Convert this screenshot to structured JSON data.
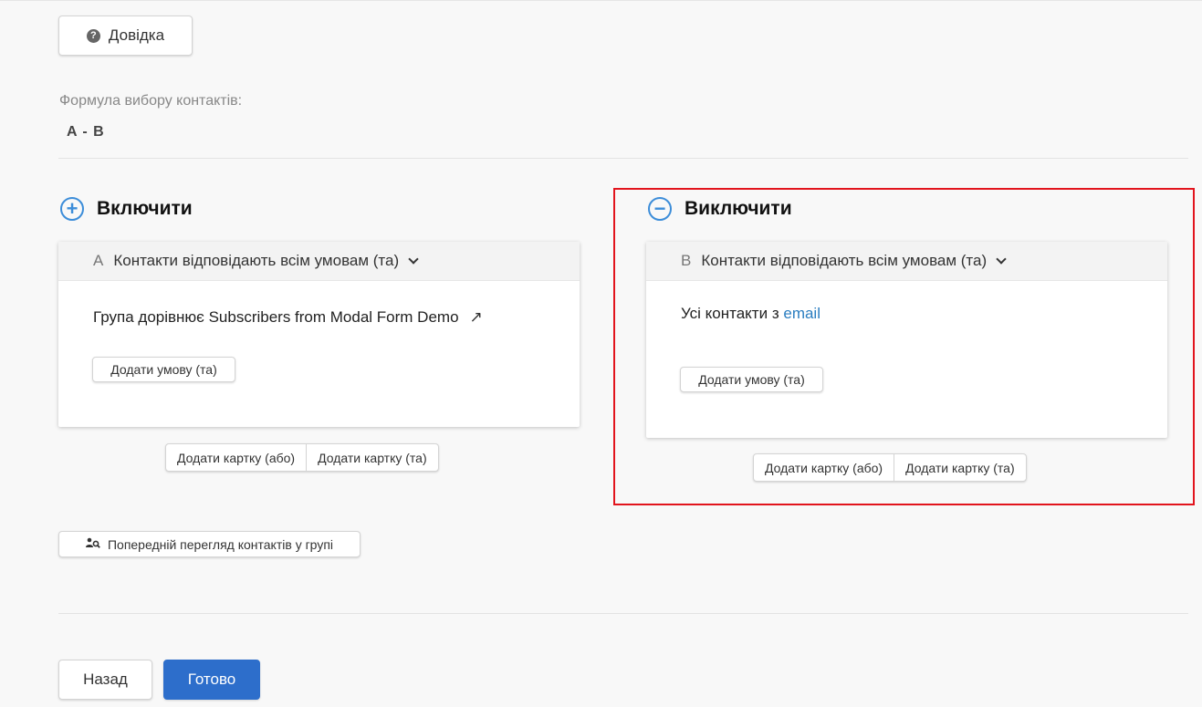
{
  "help": {
    "label": "Довідка"
  },
  "formula": {
    "label": "Формула вибору контактів:",
    "value": "A - B"
  },
  "include": {
    "title": "Включити",
    "card": {
      "letter": "A",
      "match": "Контакти відповідають всім умовам (та)",
      "condition": "Група дорівнює Subscribers from Modal Form Demo",
      "add_condition": "Додати умову (та)"
    },
    "add_card_or": "Додати картку (або)",
    "add_card_and": "Додати картку (та)"
  },
  "exclude": {
    "title": "Виключити",
    "card": {
      "letter": "B",
      "match": "Контакти відповідають всім умовам (та)",
      "condition_prefix": "Усі контакти з",
      "condition_link": "email",
      "add_condition": "Додати умову (та)"
    },
    "add_card_or": "Додати картку (або)",
    "add_card_and": "Додати картку (та)"
  },
  "preview": {
    "label": "Попередній перегляд контактів у групі"
  },
  "footer": {
    "back": "Назад",
    "done": "Готово"
  },
  "colors": {
    "accent": "#3c8dd9",
    "primary_button": "#2d6ecb",
    "highlight": "#e2141d",
    "link": "#2a7dc0"
  }
}
